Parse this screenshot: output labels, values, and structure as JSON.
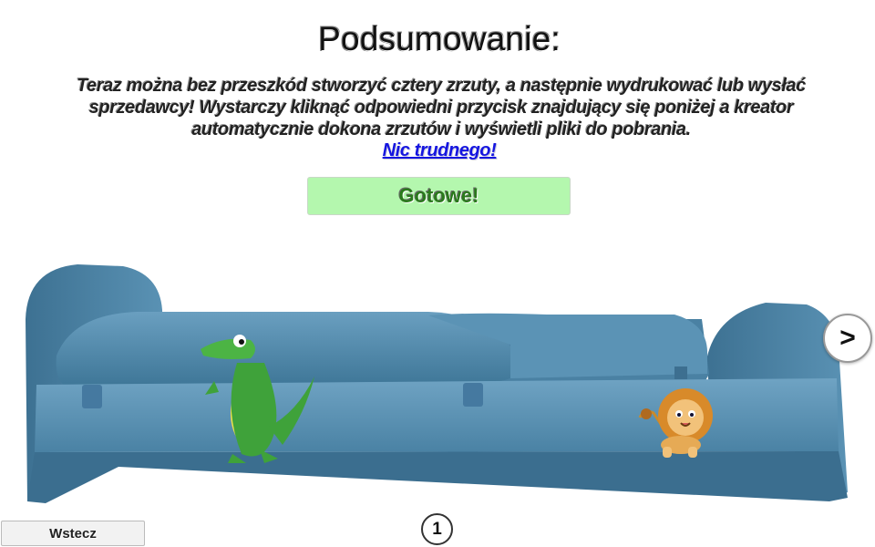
{
  "summary": {
    "title": "Podsumowanie:",
    "description": "Teraz można bez przeszkód stworzyć cztery zrzuty, a następnie wydrukować lub wysłać sprzedawcy! Wystarczy kliknąć odpowiedni przycisk znajdujący się poniżej a kreator automatycznie dokona zrzutów i wyświetli pliki do pobrania.",
    "highlight": "Nic trudnego!",
    "done_label": "Gotowe!"
  },
  "preview": {
    "product": "sofa-bed",
    "upholstery_color": "#4f8aad",
    "stickers": [
      "crocodile-sticker",
      "lion-sticker"
    ],
    "next_label": ">"
  },
  "navigation": {
    "back_label": "Wstecz",
    "current_page": "1"
  }
}
